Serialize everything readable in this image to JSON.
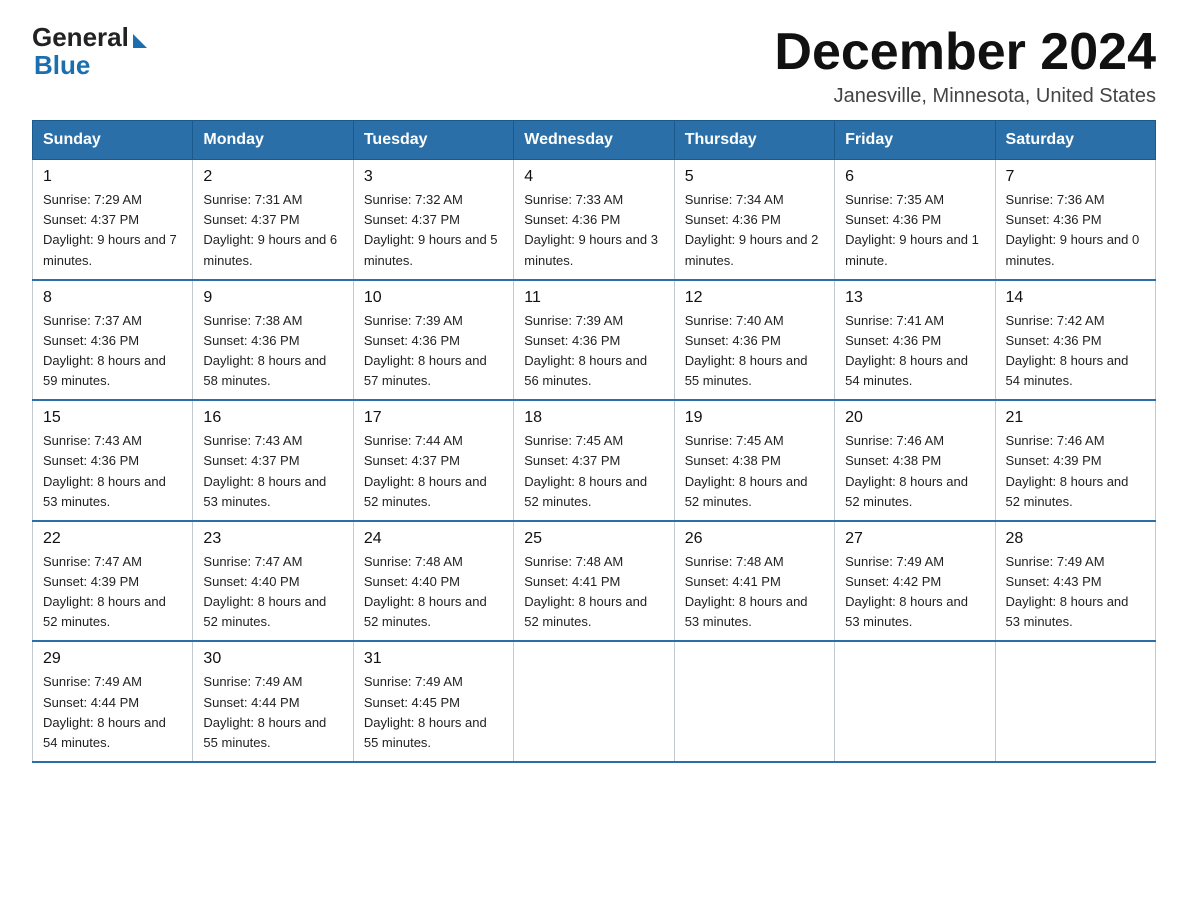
{
  "logo": {
    "general": "General",
    "blue": "Blue"
  },
  "title": {
    "month": "December 2024",
    "location": "Janesville, Minnesota, United States"
  },
  "headers": [
    "Sunday",
    "Monday",
    "Tuesday",
    "Wednesday",
    "Thursday",
    "Friday",
    "Saturday"
  ],
  "weeks": [
    [
      {
        "day": "1",
        "sunrise": "7:29 AM",
        "sunset": "4:37 PM",
        "daylight": "9 hours and 7 minutes."
      },
      {
        "day": "2",
        "sunrise": "7:31 AM",
        "sunset": "4:37 PM",
        "daylight": "9 hours and 6 minutes."
      },
      {
        "day": "3",
        "sunrise": "7:32 AM",
        "sunset": "4:37 PM",
        "daylight": "9 hours and 5 minutes."
      },
      {
        "day": "4",
        "sunrise": "7:33 AM",
        "sunset": "4:36 PM",
        "daylight": "9 hours and 3 minutes."
      },
      {
        "day": "5",
        "sunrise": "7:34 AM",
        "sunset": "4:36 PM",
        "daylight": "9 hours and 2 minutes."
      },
      {
        "day": "6",
        "sunrise": "7:35 AM",
        "sunset": "4:36 PM",
        "daylight": "9 hours and 1 minute."
      },
      {
        "day": "7",
        "sunrise": "7:36 AM",
        "sunset": "4:36 PM",
        "daylight": "9 hours and 0 minutes."
      }
    ],
    [
      {
        "day": "8",
        "sunrise": "7:37 AM",
        "sunset": "4:36 PM",
        "daylight": "8 hours and 59 minutes."
      },
      {
        "day": "9",
        "sunrise": "7:38 AM",
        "sunset": "4:36 PM",
        "daylight": "8 hours and 58 minutes."
      },
      {
        "day": "10",
        "sunrise": "7:39 AM",
        "sunset": "4:36 PM",
        "daylight": "8 hours and 57 minutes."
      },
      {
        "day": "11",
        "sunrise": "7:39 AM",
        "sunset": "4:36 PM",
        "daylight": "8 hours and 56 minutes."
      },
      {
        "day": "12",
        "sunrise": "7:40 AM",
        "sunset": "4:36 PM",
        "daylight": "8 hours and 55 minutes."
      },
      {
        "day": "13",
        "sunrise": "7:41 AM",
        "sunset": "4:36 PM",
        "daylight": "8 hours and 54 minutes."
      },
      {
        "day": "14",
        "sunrise": "7:42 AM",
        "sunset": "4:36 PM",
        "daylight": "8 hours and 54 minutes."
      }
    ],
    [
      {
        "day": "15",
        "sunrise": "7:43 AM",
        "sunset": "4:36 PM",
        "daylight": "8 hours and 53 minutes."
      },
      {
        "day": "16",
        "sunrise": "7:43 AM",
        "sunset": "4:37 PM",
        "daylight": "8 hours and 53 minutes."
      },
      {
        "day": "17",
        "sunrise": "7:44 AM",
        "sunset": "4:37 PM",
        "daylight": "8 hours and 52 minutes."
      },
      {
        "day": "18",
        "sunrise": "7:45 AM",
        "sunset": "4:37 PM",
        "daylight": "8 hours and 52 minutes."
      },
      {
        "day": "19",
        "sunrise": "7:45 AM",
        "sunset": "4:38 PM",
        "daylight": "8 hours and 52 minutes."
      },
      {
        "day": "20",
        "sunrise": "7:46 AM",
        "sunset": "4:38 PM",
        "daylight": "8 hours and 52 minutes."
      },
      {
        "day": "21",
        "sunrise": "7:46 AM",
        "sunset": "4:39 PM",
        "daylight": "8 hours and 52 minutes."
      }
    ],
    [
      {
        "day": "22",
        "sunrise": "7:47 AM",
        "sunset": "4:39 PM",
        "daylight": "8 hours and 52 minutes."
      },
      {
        "day": "23",
        "sunrise": "7:47 AM",
        "sunset": "4:40 PM",
        "daylight": "8 hours and 52 minutes."
      },
      {
        "day": "24",
        "sunrise": "7:48 AM",
        "sunset": "4:40 PM",
        "daylight": "8 hours and 52 minutes."
      },
      {
        "day": "25",
        "sunrise": "7:48 AM",
        "sunset": "4:41 PM",
        "daylight": "8 hours and 52 minutes."
      },
      {
        "day": "26",
        "sunrise": "7:48 AM",
        "sunset": "4:41 PM",
        "daylight": "8 hours and 53 minutes."
      },
      {
        "day": "27",
        "sunrise": "7:49 AM",
        "sunset": "4:42 PM",
        "daylight": "8 hours and 53 minutes."
      },
      {
        "day": "28",
        "sunrise": "7:49 AM",
        "sunset": "4:43 PM",
        "daylight": "8 hours and 53 minutes."
      }
    ],
    [
      {
        "day": "29",
        "sunrise": "7:49 AM",
        "sunset": "4:44 PM",
        "daylight": "8 hours and 54 minutes."
      },
      {
        "day": "30",
        "sunrise": "7:49 AM",
        "sunset": "4:44 PM",
        "daylight": "8 hours and 55 minutes."
      },
      {
        "day": "31",
        "sunrise": "7:49 AM",
        "sunset": "4:45 PM",
        "daylight": "8 hours and 55 minutes."
      },
      null,
      null,
      null,
      null
    ]
  ],
  "labels": {
    "sunrise": "Sunrise:",
    "sunset": "Sunset:",
    "daylight": "Daylight:"
  }
}
